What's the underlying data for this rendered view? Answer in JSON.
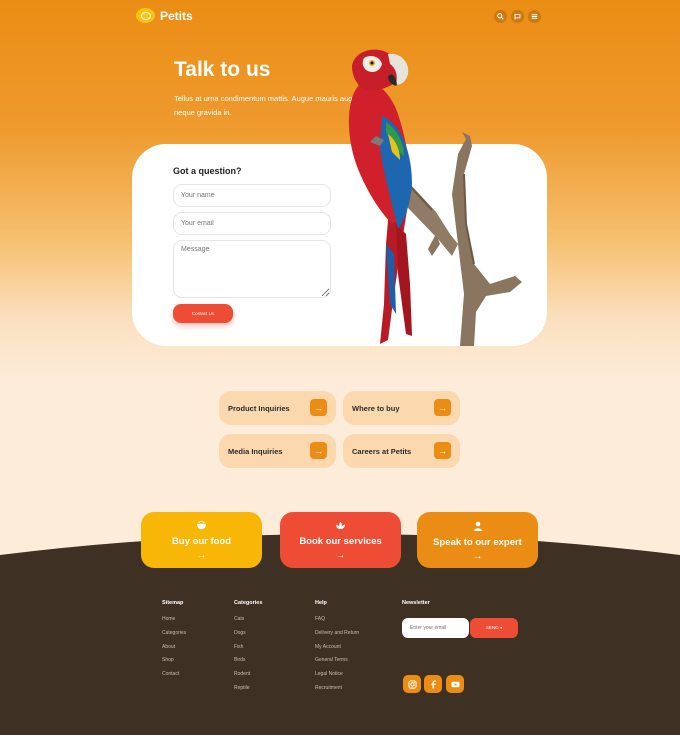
{
  "header": {
    "logo_text": "Petits",
    "icons": [
      "search-icon",
      "flag-icon",
      "menu-icon"
    ]
  },
  "hero": {
    "title": "Talk to us",
    "subtitle": "Tellus at urna condimentum mattis. Augue mauris augue neque gravida in."
  },
  "form": {
    "title": "Got a question?",
    "name_placeholder": "Your name",
    "email_placeholder": "Your email",
    "message_placeholder": "Message",
    "submit_label": "Contact Us"
  },
  "tiles": [
    {
      "label": "Product Inquiries"
    },
    {
      "label": "Where to buy"
    },
    {
      "label": "Media Inquiries"
    },
    {
      "label": "Careers at Petits"
    }
  ],
  "cta": [
    {
      "label": "Buy our food",
      "icon": "bowl-icon",
      "color": "#f8b606"
    },
    {
      "label": "Book our services",
      "icon": "lotus-icon",
      "color": "#ef4c36"
    },
    {
      "label": "Speak to our expert",
      "icon": "person-icon",
      "color": "#eb8d14"
    }
  ],
  "footer": {
    "sitemap": {
      "heading": "Sitemap",
      "links": [
        "Home",
        "Categories",
        "About",
        "Shop",
        "Contact"
      ]
    },
    "categories": {
      "heading": "Categories",
      "links": [
        "Cats",
        "Dogs",
        "Fish",
        "Birds",
        "Rodent",
        "Reptile"
      ]
    },
    "help": {
      "heading": "Help",
      "links": [
        "FAQ",
        "Delivery and Return",
        "My Account",
        "General Terms",
        "Legal Notice",
        "Recruitment"
      ]
    },
    "newsletter": {
      "heading": "Newsletter",
      "placeholder": "Enter your email",
      "button_label": "SEND"
    },
    "social_icons": [
      "instagram-icon",
      "facebook-icon",
      "youtube-icon"
    ]
  },
  "colors": {
    "accent": "#eb8d14",
    "red": "#ef4c36",
    "yellow": "#f8b606",
    "footer_bg": "#3e3022",
    "tile_bg": "#fbd8ae"
  }
}
